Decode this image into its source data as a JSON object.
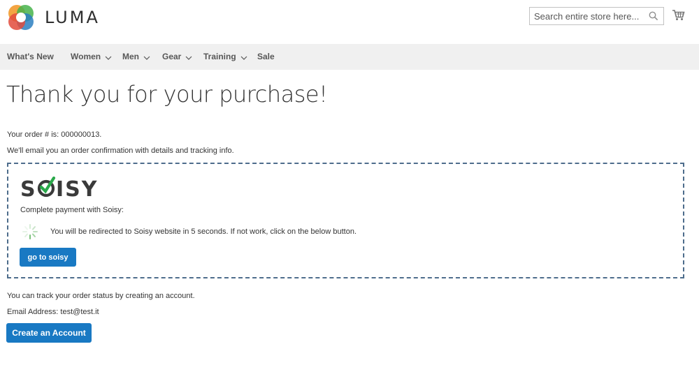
{
  "header": {
    "brand": "LUMA",
    "search_placeholder": "Search entire store here...",
    "icons": [
      "luma-logo",
      "search-icon",
      "cart-icon"
    ]
  },
  "nav": {
    "items": [
      {
        "label": "What's New",
        "has_dropdown": false
      },
      {
        "label": "Women",
        "has_dropdown": true
      },
      {
        "label": "Men",
        "has_dropdown": true
      },
      {
        "label": "Gear",
        "has_dropdown": true
      },
      {
        "label": "Training",
        "has_dropdown": true
      },
      {
        "label": "Sale",
        "has_dropdown": false
      }
    ]
  },
  "main": {
    "title": "Thank you for your purchase!",
    "order_line": "Your order # is: 000000013.",
    "email_notice": "We'll email you an order confirmation with details and tracking info.",
    "soisy": {
      "brand": "SOISY",
      "label": "Complete payment with Soisy:",
      "redirect_text": "You will be redirected to Soisy website in 5 seconds. If not work, click on the below button.",
      "button_label": "go to soisy",
      "accent_color": "#2aa84a"
    },
    "track_text": "You can track your order status by creating an account.",
    "email_address": "Email Address: test@test.it",
    "create_account_label": "Create an Account"
  },
  "colors": {
    "primary_button": "#1979c3",
    "nav_background": "#f0f0f0",
    "dashed_border": "#4e6d8c"
  }
}
